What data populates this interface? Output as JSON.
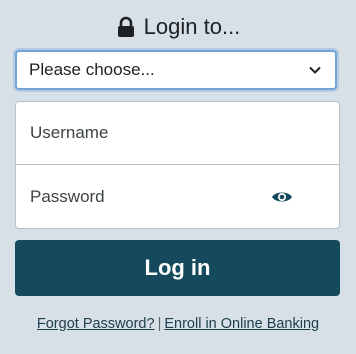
{
  "header": {
    "title": "Login to...",
    "lock_icon": "lock-icon"
  },
  "institution_select": {
    "selected": "Please choose...",
    "chevron_icon": "chevron-down-icon"
  },
  "credentials": {
    "username_placeholder": "Username",
    "password_placeholder": "Password",
    "show_password_icon": "eye-icon"
  },
  "login_button": {
    "label": "Log in"
  },
  "links": {
    "forgot_password": "Forgot Password?",
    "separator": "|",
    "enroll": "Enroll in Online Banking"
  },
  "colors": {
    "background": "#d6e0e6",
    "button": "#144a5c",
    "focus_border": "#74a4d6"
  }
}
